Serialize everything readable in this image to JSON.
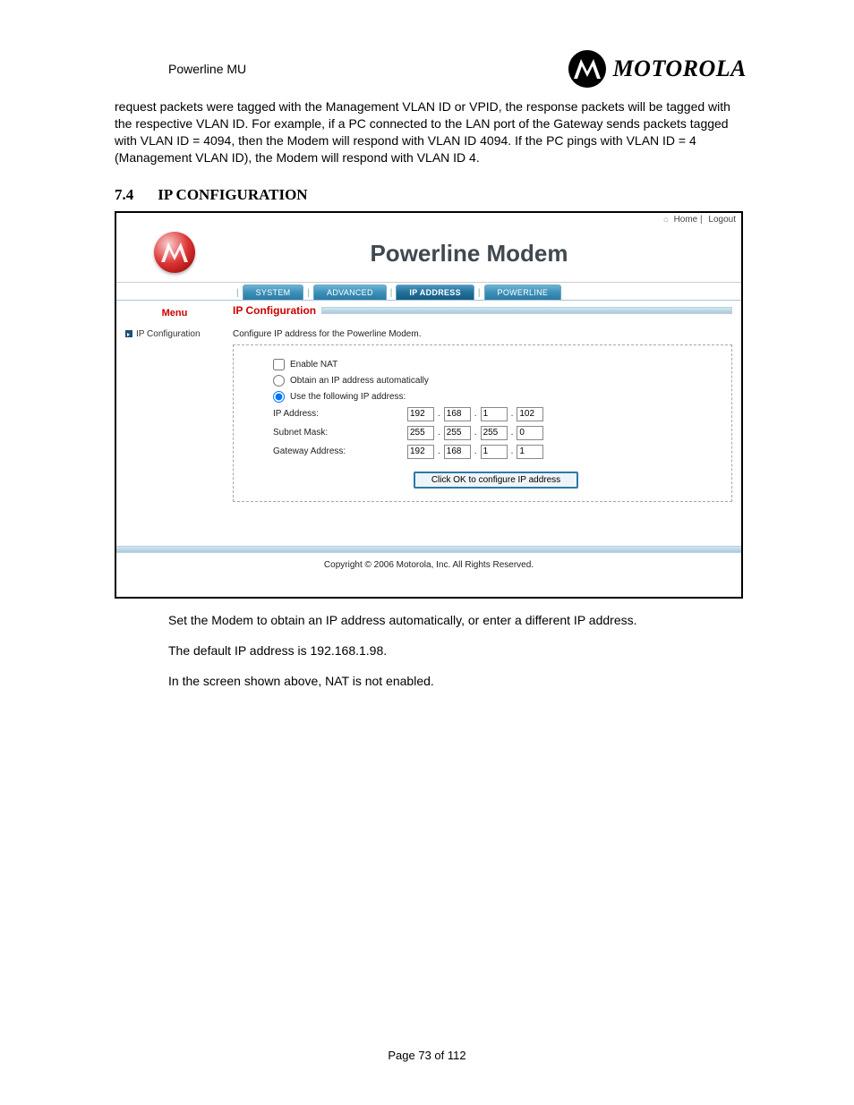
{
  "doc": {
    "header_title": "Powerline MU",
    "brand": "MOTOROLA",
    "intro_para": "request packets were tagged with the Management VLAN ID or VPID, the response packets will be tagged with the respective VLAN ID.  For example, if a PC connected to the LAN port of the Gateway sends packets tagged with VLAN ID = 4094, then the Modem will respond with VLAN ID 4094. If the PC pings with VLAN ID = 4 (Management VLAN ID), the Modem will respond with VLAN ID 4.",
    "section_num": "7.4",
    "section_title": "IP CONFIGURATION",
    "after1": "Set the Modem to obtain an IP address automatically, or enter a different IP address.",
    "after2": "The default IP address is 192.168.1.98.",
    "after3": "In the screen shown above, NAT is not enabled.",
    "page_num": "Page 73 of 112"
  },
  "ss": {
    "toplinks": {
      "home": "Home",
      "logout": "Logout"
    },
    "app_title": "Powerline Modem",
    "tabs": {
      "system": "SYSTEM",
      "advanced": "ADVANCED",
      "ip": "IP ADDRESS",
      "powerline": "POWERLINE"
    },
    "menu_head": "Menu",
    "menu_item": "IP Configuration",
    "panel_title": "IP Configuration",
    "panel_desc": "Configure IP address for the Powerline Modem.",
    "enable_nat": "Enable NAT",
    "obtain": "Obtain an IP address automatically",
    "usefollowing": "Use the following IP address:",
    "ip_label": "IP Address:",
    "subnet_label": "Subnet Mask:",
    "gw_label": "Gateway Address:",
    "ip": {
      "a": "192",
      "b": "168",
      "c": "1",
      "d": "102"
    },
    "mask": {
      "a": "255",
      "b": "255",
      "c": "255",
      "d": "0"
    },
    "gw": {
      "a": "192",
      "b": "168",
      "c": "1",
      "d": "1"
    },
    "ok_btn": "Click OK to configure IP address",
    "copyright": "Copyright  ©   2006  Motorola, Inc.  All Rights Reserved."
  }
}
